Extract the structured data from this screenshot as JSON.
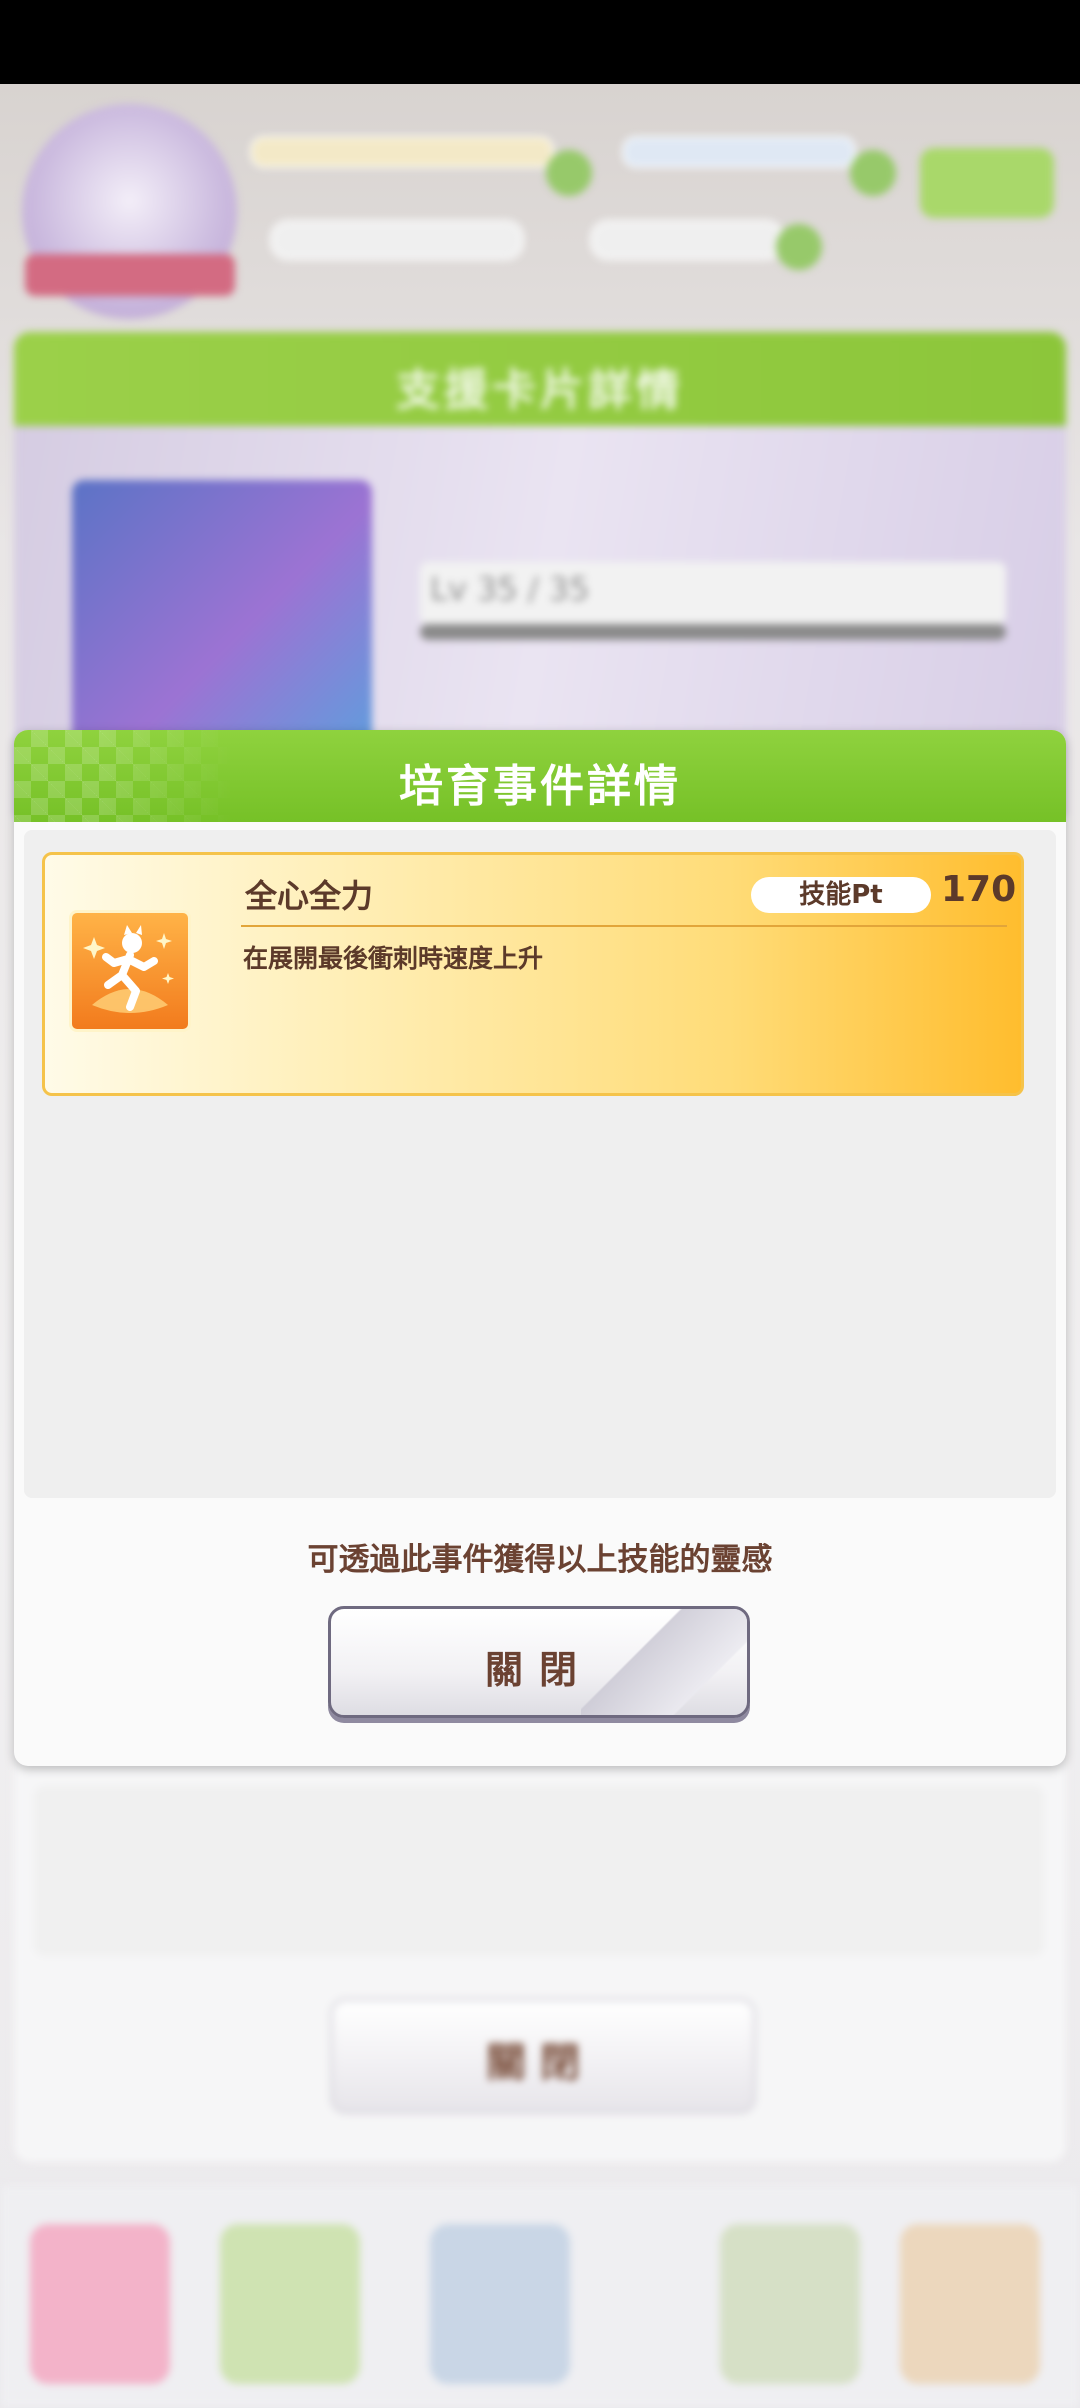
{
  "modal": {
    "title": "培育事件詳情",
    "skill": {
      "name": "全心全力",
      "pt_label": "技能Pt",
      "pt_value": "170",
      "description": "在展開最後衝刺時速度上升",
      "icon": "running-sparkle-icon"
    },
    "note": "可透過此事件獲得以上技能的靈感",
    "close_label": "關閉"
  },
  "background": {
    "panel_title": "支援卡片詳情",
    "level_text": "Lv 35 / 35",
    "close_label": "關閉"
  },
  "colors": {
    "header_green": "#7cc42c",
    "skill_card_gold": "#ffbd2e",
    "text_brown": "#6b4232"
  }
}
